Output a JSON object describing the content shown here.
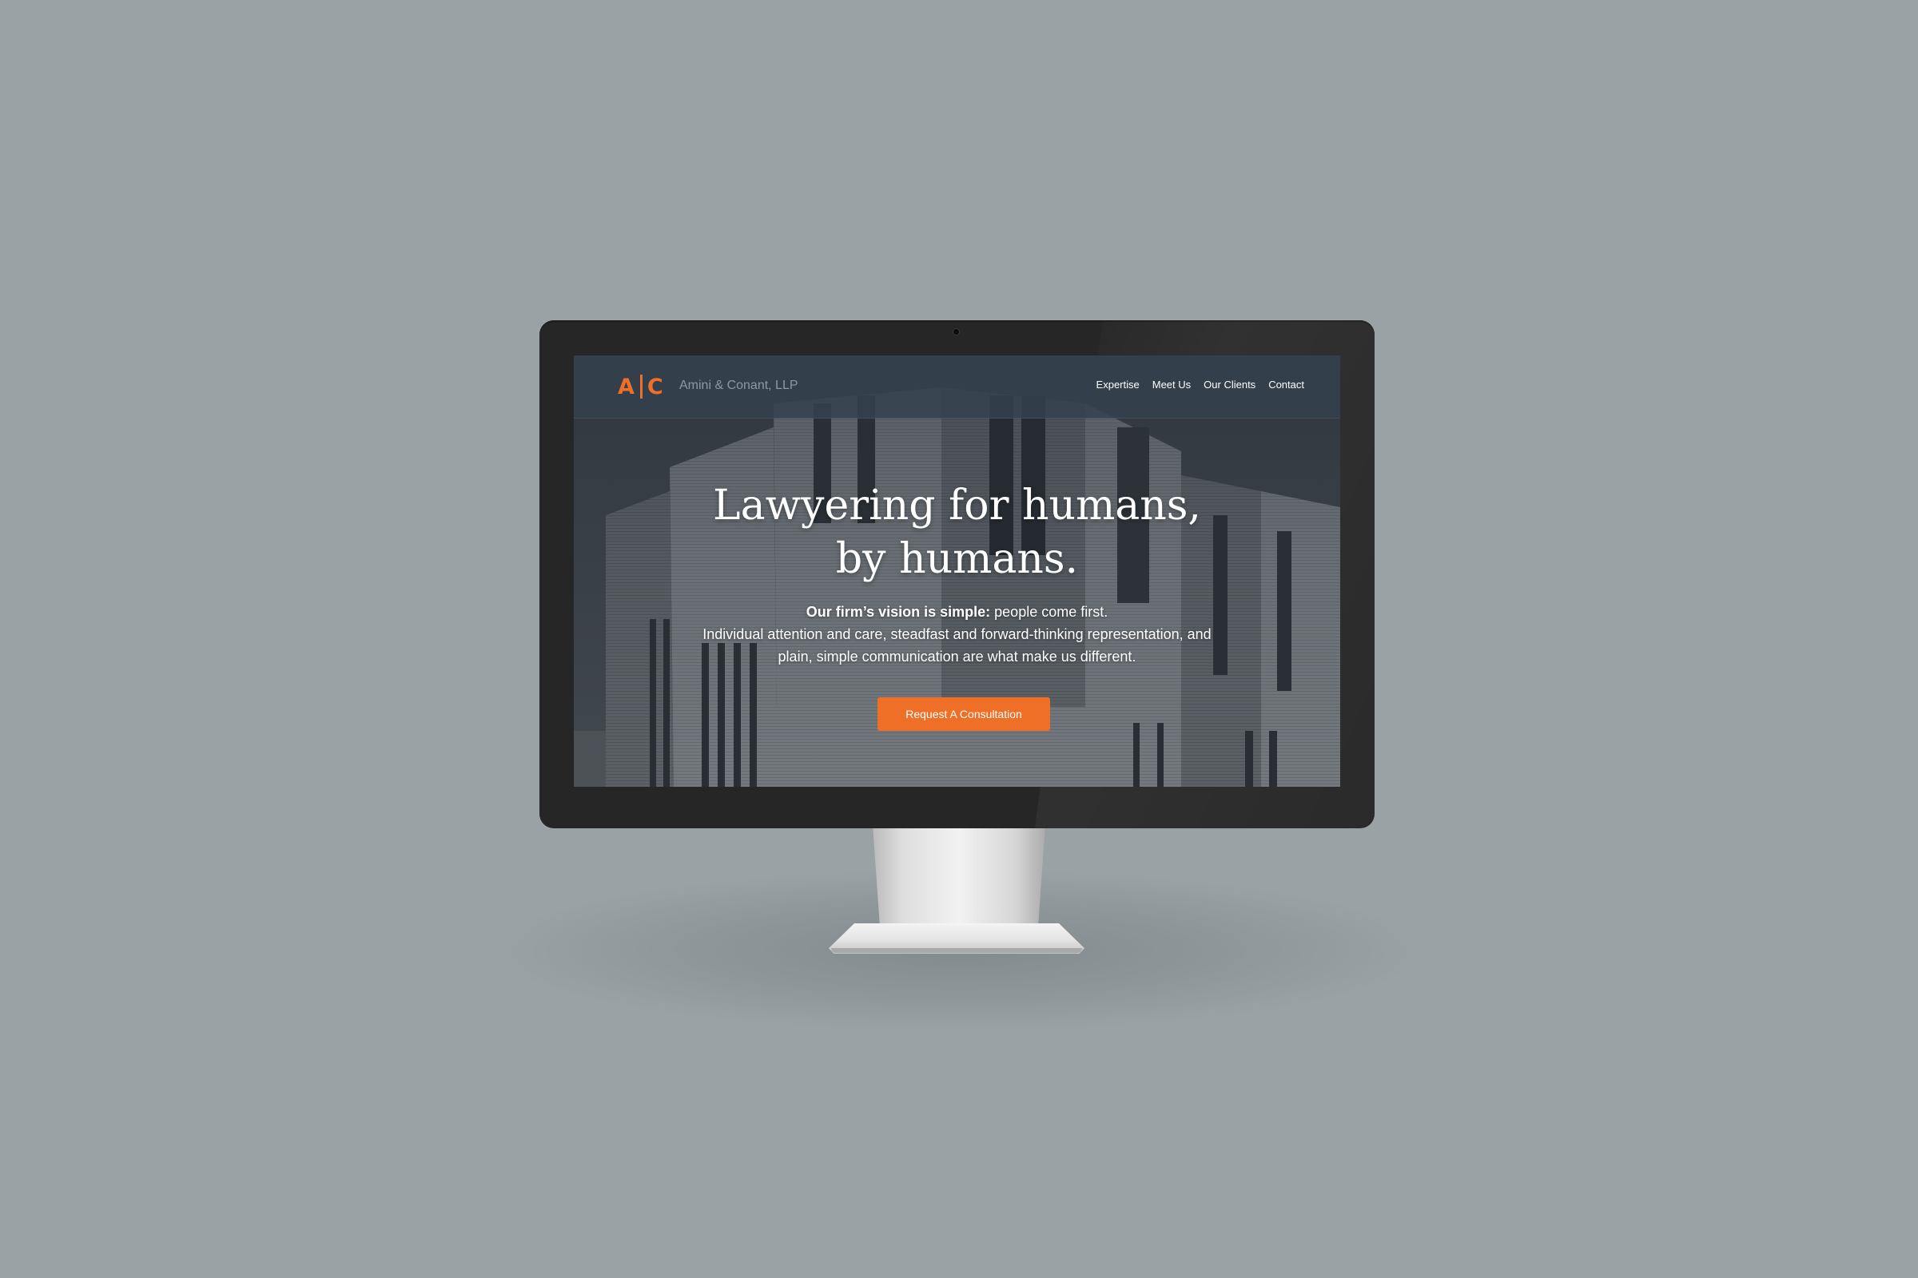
{
  "colors": {
    "backdrop": "#9aa2a6",
    "accent": "#ee6f25",
    "navbar": "#34424e",
    "bezel": "#262626"
  },
  "site": {
    "logo_left": "A",
    "logo_right": "C",
    "firm_name": "Amini & Conant, LLP"
  },
  "nav": {
    "items": [
      {
        "label": "Expertise"
      },
      {
        "label": "Meet Us"
      },
      {
        "label": "Our Clients"
      },
      {
        "label": "Contact"
      }
    ]
  },
  "hero": {
    "title_line1": "Lawyering for humans,",
    "title_line2": "by humans.",
    "vision_bold": "Our firm’s vision is simple:",
    "vision_rest": " people come first.",
    "body_line1": "Individual attention and care, steadfast and forward-thinking representation, and",
    "body_line2": "plain, simple communication are what make us different.",
    "cta_label": "Request A Consultation"
  },
  "icons": {
    "camera": "webcam-icon",
    "background": "building-photo"
  }
}
